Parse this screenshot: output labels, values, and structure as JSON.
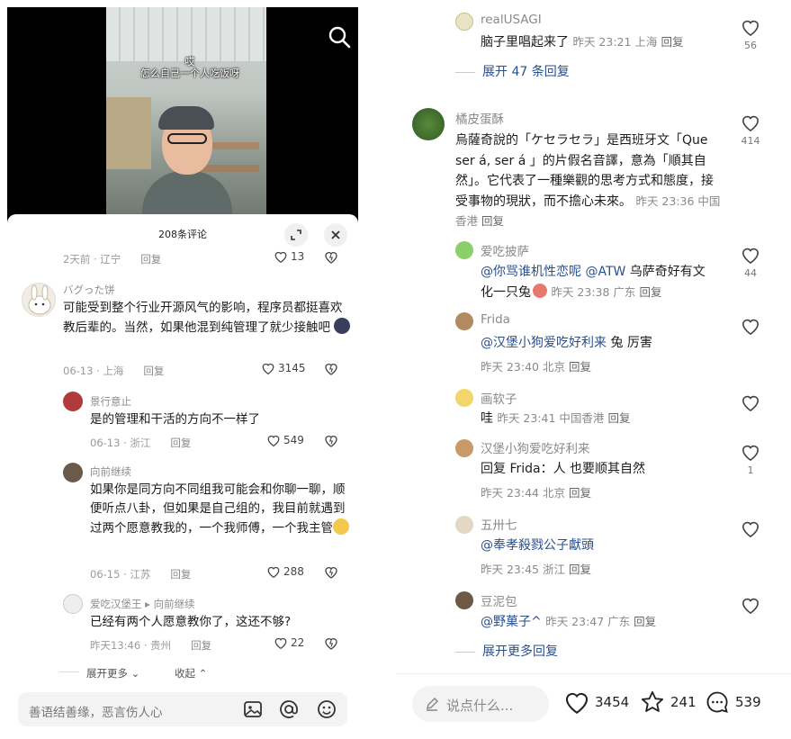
{
  "left": {
    "video": {
      "caption_line1": "哎",
      "caption_line2": "怎么自己一个人吃饭呀"
    },
    "sheet": {
      "title": "208条评论"
    },
    "top_meta": {
      "time": "2天前 · 辽宁",
      "reply": "回复",
      "likes": "13"
    },
    "comments": [
      {
        "name": "バグった饼",
        "text": "可能受到整个行业开源风气的影响，程序员都挺喜欢教后辈的。当然，如果他混到纯管理了就少接触吧",
        "time": "06-13 · 上海",
        "reply": "回复",
        "likes": "3145"
      },
      {
        "name": "景行意止",
        "text": "是的管理和干活的方向不一样了",
        "time": "06-13 · 浙江",
        "reply": "回复",
        "likes": "549"
      },
      {
        "name": "向前继续",
        "text": "如果你是同方向不同组我可能会和你聊一聊，顺便听点八卦，但如果是自己组的，我目前就遇到过两个愿意教我的，一个我师傅，一个我主管",
        "time": "06-15 · 江苏",
        "reply": "回复",
        "likes": "288"
      },
      {
        "name": "爱吃汉堡王",
        "reply_to": "向前继续",
        "text": "已经有两个人愿意教你了，这还不够?",
        "time": "昨天13:46 · 贵州",
        "reply": "回复",
        "likes": "22"
      }
    ],
    "expand_more": "展开更多",
    "collapse": "收起",
    "input_placeholder": "善语结善缘，恶言伤人心"
  },
  "right": {
    "c1": {
      "name": "realUSAGI",
      "text": "脑子里唱起来了",
      "meta": "昨天 23:21 上海",
      "reply": "回复",
      "likes": "56"
    },
    "expand1": "展开 47 条回复",
    "c2": {
      "name": "橘皮蛋酥",
      "text": "烏薩奇說的「ケセラセラ」是西班牙文「Que ser á, ser á 」的片假名音譯，意為「順其自然」。它代表了一種樂觀的思考方式和態度，接受事物的現狀，而不擔心未來。",
      "meta": "昨天 23:36 中国香港",
      "reply": "回复",
      "likes": "414"
    },
    "r1": {
      "name": "爱吃披萨",
      "mention": "@你骂谁机性恋呢 @ATW",
      "text": " 乌萨奇好有文化一只兔",
      "meta": "昨天 23:38 广东",
      "reply": "回复",
      "likes": "44"
    },
    "r2": {
      "name": "Frida",
      "mention": "@汉堡小狗爱吃好利来",
      "text": " 兔 厉害",
      "meta": "昨天 23:40 北京",
      "reply": "回复"
    },
    "r3": {
      "name": "画软子",
      "text": "哇",
      "meta": "昨天 23:41 中国香港",
      "reply": "回复"
    },
    "r4": {
      "name": "汉堡小狗爱吃好利来",
      "text": "回复  Frida：人 也要顺其自然",
      "meta": "昨天 23:44 北京",
      "reply": "回复",
      "likes": "1"
    },
    "r5": {
      "name": "五卅七",
      "mention": "@奉孝殺戮公子獻頭",
      "meta": "昨天 23:45 浙江",
      "reply": "回复"
    },
    "r6": {
      "name": "豆泥包",
      "mention": "@野菓子^",
      "meta": "昨天 23:47 广东",
      "reply": "回复"
    },
    "expand2": "展开更多回复",
    "bottom": {
      "placeholder": "说点什么...",
      "likes": "3454",
      "stars": "241",
      "comments": "539"
    }
  }
}
